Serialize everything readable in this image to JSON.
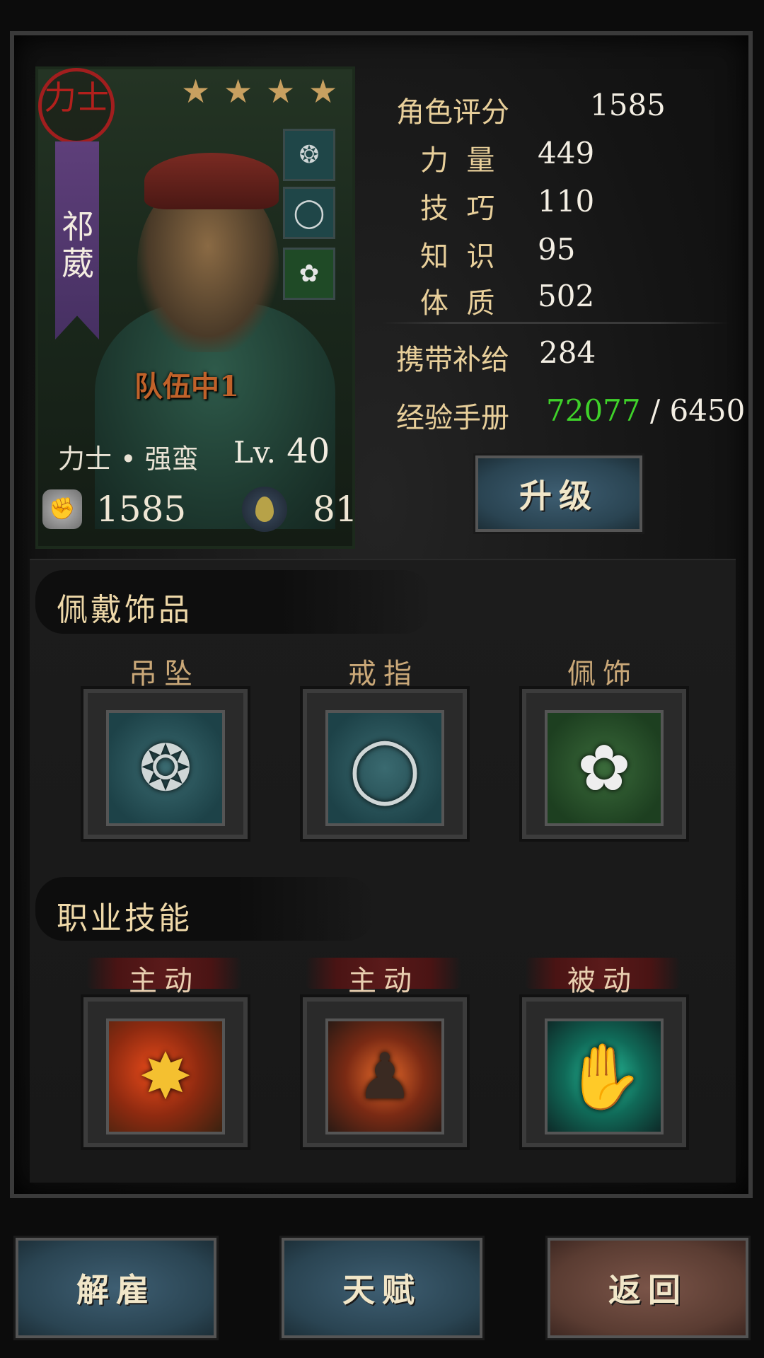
{
  "hero": {
    "class_seal": "力士",
    "name": "祁葳",
    "stars": 4,
    "team_status": "队伍中1",
    "class_line": "力士 • 强蛮",
    "level_prefix": "Lv.",
    "level": "40",
    "power": "1585",
    "mana": "81",
    "mini_equipment": [
      "pendant-icon",
      "ring-icon",
      "ornament-icon"
    ]
  },
  "stats": {
    "score_label": "角色评分",
    "score_value": "1585",
    "strength_label": "力  量",
    "strength_value": "449",
    "skill_label": "技  巧",
    "skill_value": "110",
    "knowledge_label": "知  识",
    "knowledge_value": "95",
    "constitution_label": "体  质",
    "constitution_value": "502",
    "supply_label": "携带补给",
    "supply_value": "284",
    "exp_label": "经验手册",
    "exp_current": "72077",
    "exp_sep": " / ",
    "exp_required": "6450",
    "upgrade_label": "升级"
  },
  "accessories": {
    "title": "佩戴饰品",
    "slots": [
      {
        "label": "吊坠",
        "icon": "pendant-icon"
      },
      {
        "label": "戒指",
        "icon": "ring-icon"
      },
      {
        "label": "佩饰",
        "icon": "ornament-icon"
      }
    ]
  },
  "skills": {
    "title": "职业技能",
    "slots": [
      {
        "label": "主动",
        "icon": "smash-skill-icon"
      },
      {
        "label": "主动",
        "icon": "rage-skill-icon"
      },
      {
        "label": "被动",
        "icon": "passive-skill-icon"
      }
    ]
  },
  "bottom_buttons": {
    "dismiss": "解雇",
    "talent": "天赋",
    "back": "返回"
  },
  "colors": {
    "exp_current": "#3fd22a",
    "accent_gold": "#e8cf9a",
    "seal_red": "#a11e1e",
    "banner_purple": "#5e3f7a"
  }
}
